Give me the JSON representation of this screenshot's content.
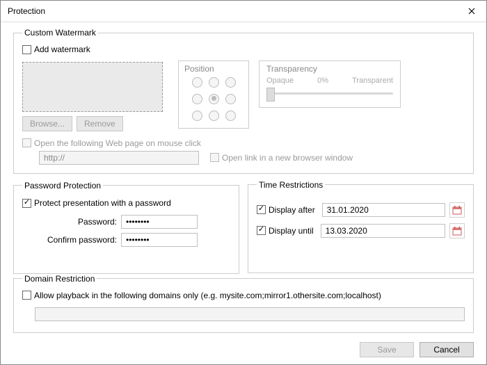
{
  "window": {
    "title": "Protection"
  },
  "watermark": {
    "legend": "Custom Watermark",
    "add_label": "Add watermark",
    "browse_label": "Browse...",
    "remove_label": "Remove",
    "position_label": "Position",
    "transparency": {
      "label": "Transparency",
      "left": "Opaque",
      "mid": "0%",
      "right": "Transparent"
    },
    "web_on_click_label": "Open the following Web page on mouse click",
    "url_value": "http://",
    "new_window_label": "Open link in a new browser window"
  },
  "password": {
    "legend": "Password Protection",
    "protect_label": "Protect presentation with a password",
    "password_label": "Password:",
    "confirm_label": "Confirm password:",
    "password_value": "••••••••",
    "confirm_value": "••••••••"
  },
  "time": {
    "legend": "Time Restrictions",
    "after_label": "Display after",
    "until_label": "Display until",
    "after_value": "31.01.2020",
    "until_value": "13.03.2020"
  },
  "domain": {
    "legend": "Domain Restriction",
    "allow_label": "Allow playback in the following domains only (e.g. mysite.com;mirror1.othersite.com;localhost)"
  },
  "footer": {
    "save_label": "Save",
    "cancel_label": "Cancel"
  }
}
